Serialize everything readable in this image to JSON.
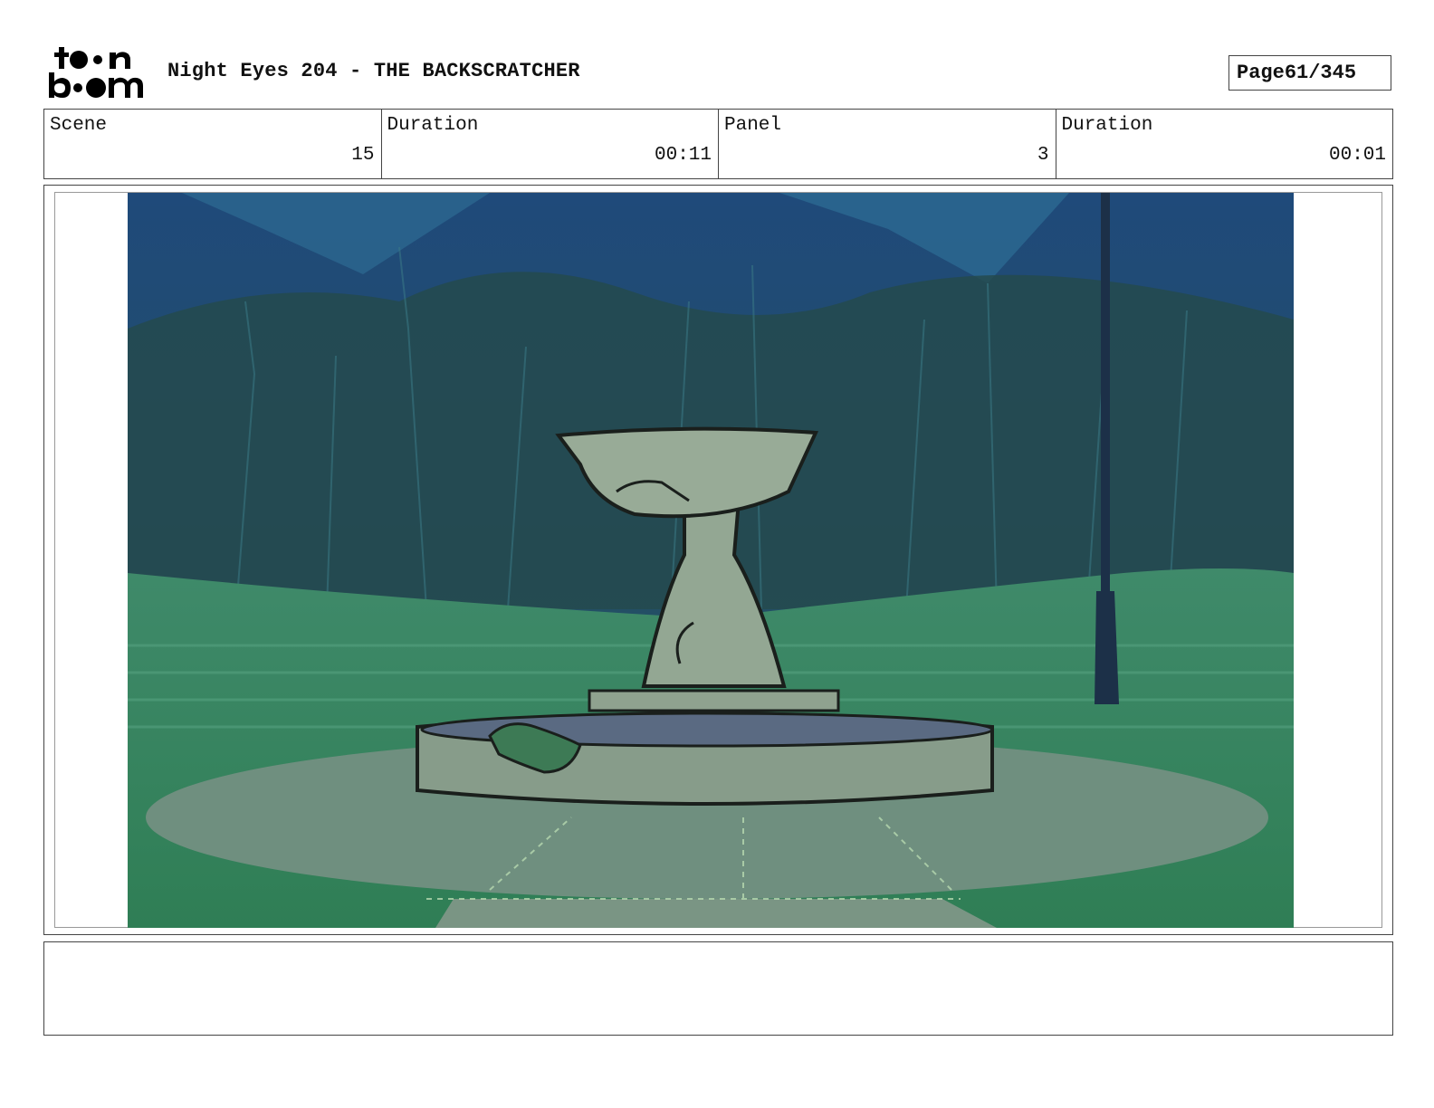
{
  "header": {
    "logo_text": "toon boom",
    "title": "Night Eyes 204 - THE BACKSCRATCHER",
    "page_label": "Page",
    "page_value": "61/345"
  },
  "info": {
    "scene_label": "Scene",
    "scene_value": "15",
    "scene_duration_label": "Duration",
    "scene_duration_value": "00:11",
    "panel_label": "Panel",
    "panel_value": "3",
    "panel_duration_label": "Duration",
    "panel_duration_value": "00:01"
  },
  "notes": {
    "text": ""
  }
}
